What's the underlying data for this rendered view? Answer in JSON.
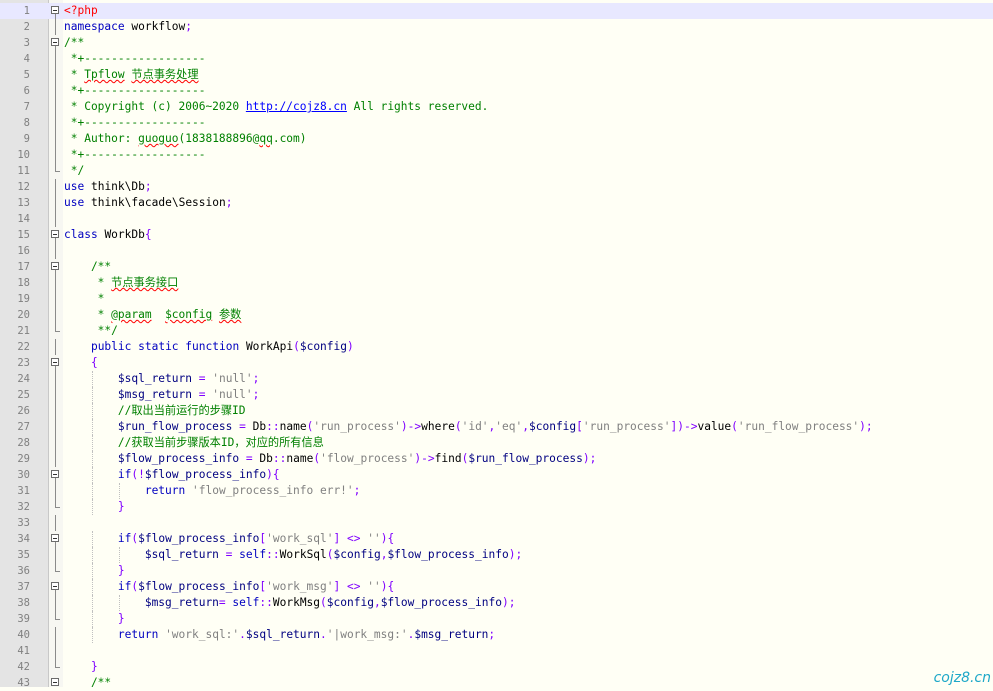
{
  "watermark": "cojz8.cn",
  "lines": [
    {
      "n": "1",
      "t": "<?php"
    },
    {
      "n": "2",
      "t": "namespace workflow;"
    },
    {
      "n": "3",
      "t": "/**"
    },
    {
      "n": "4",
      "t": " *+------------------"
    },
    {
      "n": "5",
      "t": " * Tpflow 节点事务处理"
    },
    {
      "n": "6",
      "t": " *+------------------"
    },
    {
      "n": "7",
      "t": " * Copyright (c) 2006~2020 http://cojz8.cn All rights reserved."
    },
    {
      "n": "8",
      "t": " *+------------------"
    },
    {
      "n": "9",
      "t": " * Author: guoguo(1838188896@qq.com)"
    },
    {
      "n": "10",
      "t": " *+------------------"
    },
    {
      "n": "11",
      "t": " */"
    },
    {
      "n": "12",
      "t": "use think\\Db;"
    },
    {
      "n": "13",
      "t": "use think\\facade\\Session;"
    },
    {
      "n": "14",
      "t": ""
    },
    {
      "n": "15",
      "t": "class WorkDb{"
    },
    {
      "n": "16",
      "t": ""
    },
    {
      "n": "17",
      "t": "    /**"
    },
    {
      "n": "18",
      "t": "     * 节点事务接口"
    },
    {
      "n": "19",
      "t": "     *"
    },
    {
      "n": "20",
      "t": "     * @param  $config 参数"
    },
    {
      "n": "21",
      "t": "     **/"
    },
    {
      "n": "22",
      "t": "    public static function WorkApi($config)"
    },
    {
      "n": "23",
      "t": "    {"
    },
    {
      "n": "24",
      "t": "        $sql_return = 'null';"
    },
    {
      "n": "25",
      "t": "        $msg_return = 'null';"
    },
    {
      "n": "26",
      "t": "        //取出当前运行的步骤ID"
    },
    {
      "n": "27",
      "t": "        $run_flow_process = Db::name('run_process')->where('id','eq',$config['run_process'])->value('run_flow_process');"
    },
    {
      "n": "28",
      "t": "        //获取当前步骤版本ID，对应的所有信息"
    },
    {
      "n": "29",
      "t": "        $flow_process_info = Db::name('flow_process')->find($run_flow_process);"
    },
    {
      "n": "30",
      "t": "        if(!$flow_process_info){"
    },
    {
      "n": "31",
      "t": "            return 'flow_process_info err!';"
    },
    {
      "n": "32",
      "t": "        }"
    },
    {
      "n": "33",
      "t": ""
    },
    {
      "n": "34",
      "t": "        if($flow_process_info['work_sql'] <> ''){"
    },
    {
      "n": "35",
      "t": "            $sql_return = self::WorkSql($config,$flow_process_info);"
    },
    {
      "n": "36",
      "t": "        }"
    },
    {
      "n": "37",
      "t": "        if($flow_process_info['work_msg'] <> ''){"
    },
    {
      "n": "38",
      "t": "            $msg_return= self::WorkMsg($config,$flow_process_info);"
    },
    {
      "n": "39",
      "t": "        }"
    },
    {
      "n": "40",
      "t": "        return 'work_sql:'.$sql_return.'|work_msg:'.$msg_return;"
    },
    {
      "n": "41",
      "t": ""
    },
    {
      "n": "42",
      "t": "    }"
    },
    {
      "n": "43",
      "t": "    /**"
    }
  ]
}
